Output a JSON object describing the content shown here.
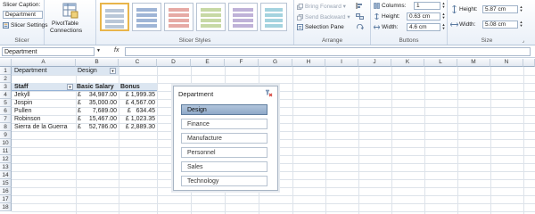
{
  "ribbon": {
    "slicer_group": {
      "caption_label": "Slicer Caption:",
      "caption_value": "Department",
      "settings_label": "Slicer Settings",
      "group_label": "Slicer"
    },
    "pivot_connections": {
      "line1": "PivotTable",
      "line2": "Connections"
    },
    "slicer_styles": {
      "group_label": "Slicer Styles"
    },
    "arrange": {
      "bring_forward": "Bring Forward",
      "send_backward": "Send Backward",
      "selection_pane": "Selection Pane",
      "group_label": "Arrange"
    },
    "buttons": {
      "columns_label": "Columns:",
      "columns_value": "1",
      "height_label": "Height:",
      "height_value": "0.63 cm",
      "width_label": "Width:",
      "width_value": "4.6 cm",
      "group_label": "Buttons"
    },
    "size": {
      "height_label": "Height:",
      "height_value": "5.87 cm",
      "width_label": "Width:",
      "width_value": "5.08 cm",
      "group_label": "Size"
    }
  },
  "formula_bar": {
    "name_box": "Department",
    "fx": "fx",
    "content": ""
  },
  "columns": [
    "A",
    "B",
    "C",
    "D",
    "E",
    "F",
    "G",
    "H",
    "I",
    "J",
    "K",
    "L",
    "M",
    "N"
  ],
  "rows": [
    "1",
    "2",
    "3",
    "4",
    "5",
    "6",
    "7",
    "8",
    "9",
    "10",
    "11",
    "12",
    "13",
    "14",
    "15",
    "16",
    "17",
    "18"
  ],
  "cells": {
    "a1": "Department",
    "b1": "Design",
    "a3": "Staff",
    "b3": "Basic Salary",
    "c3": "Bonus",
    "staff": [
      {
        "name": "Jekyll",
        "cur1": "£",
        "salary": "34,987.00",
        "bonus": "£ 1,999.35"
      },
      {
        "name": "Jospin",
        "cur1": "£",
        "salary": "35,000.00",
        "bonus": "£ 4,567.00"
      },
      {
        "name": "Pullen",
        "cur1": "£",
        "salary": "7,689.00",
        "bonus": "£   634.45"
      },
      {
        "name": "Robinson",
        "cur1": "£",
        "salary": "15,467.00",
        "bonus": "£ 1,023.35"
      },
      {
        "name": "Sierra de la Guerra",
        "cur1": "£",
        "salary": "52,786.00",
        "bonus": "£ 2,889.30"
      }
    ]
  },
  "slicer": {
    "title": "Department",
    "items": [
      "Design",
      "Finance",
      "Manufacture",
      "Personnel",
      "Sales",
      "Technology"
    ],
    "selected": "Design"
  },
  "colors": {
    "accent": "#e8b54a",
    "slicer_selected": "#9db3cf"
  }
}
